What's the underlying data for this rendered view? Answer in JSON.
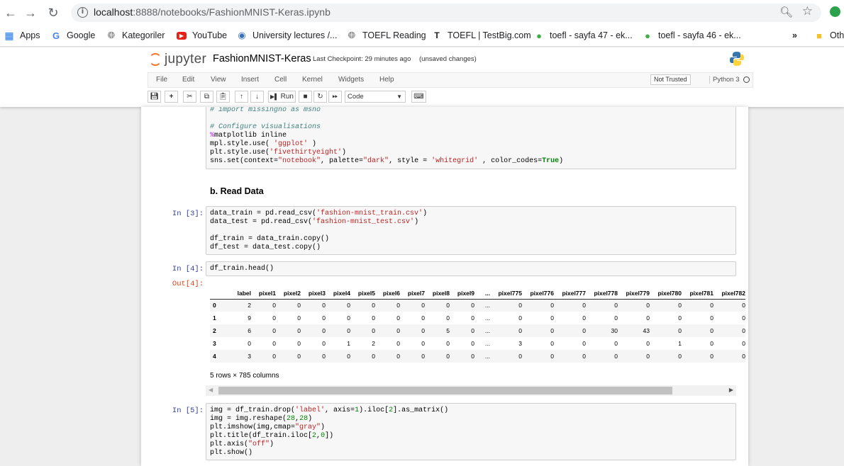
{
  "browser": {
    "url_host": "localhost",
    "url_rest": ":8888/notebooks/FashionMNIST-Keras.ipynb",
    "bookmarks": [
      {
        "label": "Apps",
        "icon": "apps-grid-icon"
      },
      {
        "label": "Google",
        "icon": "google-icon"
      },
      {
        "label": "Kategoriler",
        "icon": "globe-icon"
      },
      {
        "label": "YouTube",
        "icon": "youtube-icon"
      },
      {
        "label": "University lectures /...",
        "icon": "university-icon"
      },
      {
        "label": "TOEFL Reading",
        "icon": "globe-icon"
      },
      {
        "label": "TOEFL | TestBig.com",
        "icon": "testbig-icon"
      },
      {
        "label": "toefl - sayfa 47 - ek...",
        "icon": "leaf-icon"
      },
      {
        "label": "toefl - sayfa 46 - ek...",
        "icon": "leaf-icon"
      },
      {
        "label": "»",
        "icon": "overflow-icon"
      },
      {
        "label": "Oth",
        "icon": "folder-icon"
      }
    ]
  },
  "jupyter": {
    "logo_text": "jupyter",
    "notebook_name": "FashionMNIST-Keras",
    "checkpoint": "Last Checkpoint: 29 minutes ago",
    "unsaved": "(unsaved changes)",
    "menu": [
      "File",
      "Edit",
      "View",
      "Insert",
      "Cell",
      "Kernel",
      "Widgets",
      "Help"
    ],
    "not_trusted": "Not Trusted",
    "kernel": "Python 3",
    "toolbar": {
      "run_label": "Run",
      "cell_type": "Code"
    }
  },
  "cells": {
    "cell_prev": {
      "lines": [
        [
          {
            "t": "# import missingno as msno",
            "c": "cm"
          }
        ],
        [
          {
            "t": "",
            "c": ""
          }
        ],
        [
          {
            "t": "# Configure visualisations",
            "c": "cm"
          }
        ],
        [
          {
            "t": "%",
            "c": "mg"
          },
          {
            "t": "matplotlib inline",
            "c": ""
          }
        ],
        [
          {
            "t": "mpl.style.use( ",
            "c": ""
          },
          {
            "t": "'ggplot'",
            "c": "str"
          },
          {
            "t": " )",
            "c": ""
          }
        ],
        [
          {
            "t": "plt.style.use(",
            "c": ""
          },
          {
            "t": "'fivethirtyeight'",
            "c": "str"
          },
          {
            "t": ")",
            "c": ""
          }
        ],
        [
          {
            "t": "sns.set(context=",
            "c": ""
          },
          {
            "t": "\"notebook\"",
            "c": "str"
          },
          {
            "t": ", palette=",
            "c": ""
          },
          {
            "t": "\"dark\"",
            "c": "str"
          },
          {
            "t": ", style = ",
            "c": ""
          },
          {
            "t": "'whitegrid'",
            "c": "str"
          },
          {
            "t": " , color_codes=",
            "c": ""
          },
          {
            "t": "True",
            "c": "kw"
          },
          {
            "t": ")",
            "c": ""
          }
        ]
      ]
    },
    "heading": "b. Read Data",
    "cell3": {
      "prompt": "In [3]:",
      "lines": [
        [
          {
            "t": "data_train = pd.read_csv(",
            "c": ""
          },
          {
            "t": "'fashion-mnist_train.csv'",
            "c": "str"
          },
          {
            "t": ")",
            "c": ""
          }
        ],
        [
          {
            "t": "data_test = pd.read_csv(",
            "c": ""
          },
          {
            "t": "'fashion-mnist_test.csv'",
            "c": "str"
          },
          {
            "t": ")",
            "c": ""
          }
        ],
        [
          {
            "t": "",
            "c": ""
          }
        ],
        [
          {
            "t": "df_train = data_train.copy()",
            "c": ""
          }
        ],
        [
          {
            "t": "df_test = data_test.copy()",
            "c": ""
          }
        ]
      ]
    },
    "cell4": {
      "prompt": "In [4]:",
      "out_prompt": "Out[4]:",
      "lines": [
        [
          {
            "t": "df_train.head()",
            "c": ""
          }
        ]
      ]
    },
    "cell5": {
      "prompt": "In [5]:",
      "lines": [
        [
          {
            "t": "img = df_train.drop(",
            "c": ""
          },
          {
            "t": "'label'",
            "c": "str"
          },
          {
            "t": ", axis=",
            "c": ""
          },
          {
            "t": "1",
            "c": "num"
          },
          {
            "t": ").iloc[",
            "c": ""
          },
          {
            "t": "2",
            "c": "num"
          },
          {
            "t": "].as_matrix()",
            "c": ""
          }
        ],
        [
          {
            "t": "img = img.reshape(",
            "c": ""
          },
          {
            "t": "28",
            "c": "num"
          },
          {
            "t": ",",
            "c": ""
          },
          {
            "t": "28",
            "c": "num"
          },
          {
            "t": ")",
            "c": ""
          }
        ],
        [
          {
            "t": "plt.imshow(img,cmap=",
            "c": ""
          },
          {
            "t": "\"gray\"",
            "c": "str"
          },
          {
            "t": ")",
            "c": ""
          }
        ],
        [
          {
            "t": "plt.title(df_train.iloc[",
            "c": ""
          },
          {
            "t": "2",
            "c": "num"
          },
          {
            "t": ",",
            "c": ""
          },
          {
            "t": "0",
            "c": "num"
          },
          {
            "t": "])",
            "c": ""
          }
        ],
        [
          {
            "t": "plt.axis(",
            "c": ""
          },
          {
            "t": "\"off\"",
            "c": "str"
          },
          {
            "t": ")",
            "c": ""
          }
        ],
        [
          {
            "t": "plt.show()",
            "c": ""
          }
        ]
      ]
    }
  },
  "dataframe": {
    "columns": [
      "label",
      "pixel1",
      "pixel2",
      "pixel3",
      "pixel4",
      "pixel5",
      "pixel6",
      "pixel7",
      "pixel8",
      "pixel9",
      "...",
      "pixel775",
      "pixel776",
      "pixel777",
      "pixel778",
      "pixel779",
      "pixel780",
      "pixel781",
      "pixel782"
    ],
    "index": [
      "0",
      "1",
      "2",
      "3",
      "4"
    ],
    "rows": [
      [
        "2",
        "0",
        "0",
        "0",
        "0",
        "0",
        "0",
        "0",
        "0",
        "0",
        "...",
        "0",
        "0",
        "0",
        "0",
        "0",
        "0",
        "0",
        "0"
      ],
      [
        "9",
        "0",
        "0",
        "0",
        "0",
        "0",
        "0",
        "0",
        "0",
        "0",
        "...",
        "0",
        "0",
        "0",
        "0",
        "0",
        "0",
        "0",
        "0"
      ],
      [
        "6",
        "0",
        "0",
        "0",
        "0",
        "0",
        "0",
        "0",
        "5",
        "0",
        "...",
        "0",
        "0",
        "0",
        "30",
        "43",
        "0",
        "0",
        "0"
      ],
      [
        "0",
        "0",
        "0",
        "0",
        "1",
        "2",
        "0",
        "0",
        "0",
        "0",
        "...",
        "3",
        "0",
        "0",
        "0",
        "0",
        "1",
        "0",
        "0"
      ],
      [
        "3",
        "0",
        "0",
        "0",
        "0",
        "0",
        "0",
        "0",
        "0",
        "0",
        "...",
        "0",
        "0",
        "0",
        "0",
        "0",
        "0",
        "0",
        "0"
      ]
    ],
    "shape_text": "5 rows × 785 columns"
  }
}
